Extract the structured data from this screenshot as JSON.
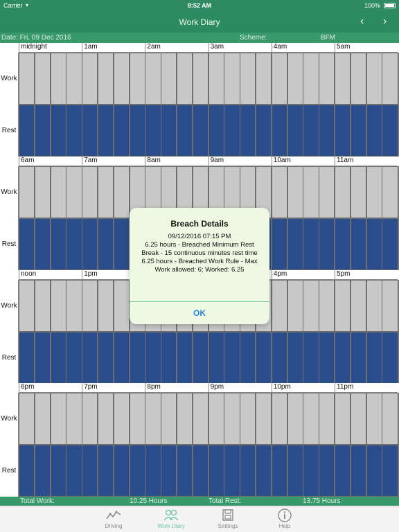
{
  "status_bar": {
    "carrier": "Carrier",
    "time": "8:52 AM",
    "battery": "100%"
  },
  "nav": {
    "title": "Work Diary",
    "prev": "‹",
    "next": "›"
  },
  "info": {
    "date_label": "Date: Fri, 09 Dec 2016",
    "scheme_label": "Scheme:",
    "scheme_value": "BFM"
  },
  "row_labels": {
    "work": "Work",
    "rest": "Rest"
  },
  "hour_labels": [
    "midnight",
    "1am",
    "2am",
    "3am",
    "4am",
    "5am",
    "6am",
    "7am",
    "8am",
    "9am",
    "10am",
    "11am",
    "noon",
    "1pm",
    "2pm",
    "3pm",
    "4pm",
    "5pm",
    "6pm",
    "7pm",
    "8pm",
    "9pm",
    "10pm",
    "11pm"
  ],
  "colors": {
    "work": "#4a8b2c",
    "rest": "#2c4d8c",
    "breach": "#b00000",
    "empty": "#c8c8c8",
    "accent": "#2e8a60"
  },
  "slots": {
    "work": "000000000000000000000000000000000000000000000000000000000000000000000000000000000000000000000000000000000000000000000000111111111000111111111111111111111111111111111111111111111111111111111111111111111111111111111111000000000000000000000000000000000000000000000000",
    "rest": "111111111111111111111111111111111111111111111111111111111111111111111111111111111111111111111111111111111111111111111111111100000000000000000000000000000000000000000000000000000000000000000000000000000000000000000000111111111111111111111111111111111111000000000000000000000000000000000000000000000000000000000000000000000000000000000000000000000000000000000000000000001111111111111111111111111111111111111111111111111",
    "breach": "000000000000000000000000000000000000000000000000000000000000000000000000000000000000000000000000000000000000000000000000000000000000000000000000000000000000000000000000000000000000000000000000000000000000000000000000000000000000000000000000000000000000000000000000000000000000000000000000000000000000000000000000000000000000000000000000000000000000000000000000000000000000000000000000000000000000000000000000000000000000000000000000000000000000000000000000000000000000000000000000000000000000000000000000000000000000000000000000000000000000000000000000000000000000000000000000000000000000000"
  },
  "totals": {
    "work_label": "Total Work:",
    "work_value": "10.25 Hours",
    "rest_label": "Total Rest:",
    "rest_value": "13.75 Hours"
  },
  "tabs": [
    {
      "label": "Driving",
      "icon": "chart-line-icon",
      "active": false
    },
    {
      "label": "Work Diary",
      "icon": "people-icon",
      "active": true
    },
    {
      "label": "Settings",
      "icon": "floppy-disk-icon",
      "active": false
    },
    {
      "label": "Help",
      "icon": "info-icon",
      "active": false
    }
  ],
  "dialog": {
    "title": "Breach Details",
    "line1": "09/12/2016 07:15 PM",
    "line2": "6.25 hours - Breached Minimum Rest Break - 15 continuous minutes rest time",
    "line3": "6.25 hours - Breached Work Rule - Max Work allowed: 6; Worked: 6.25",
    "ok": "OK"
  }
}
